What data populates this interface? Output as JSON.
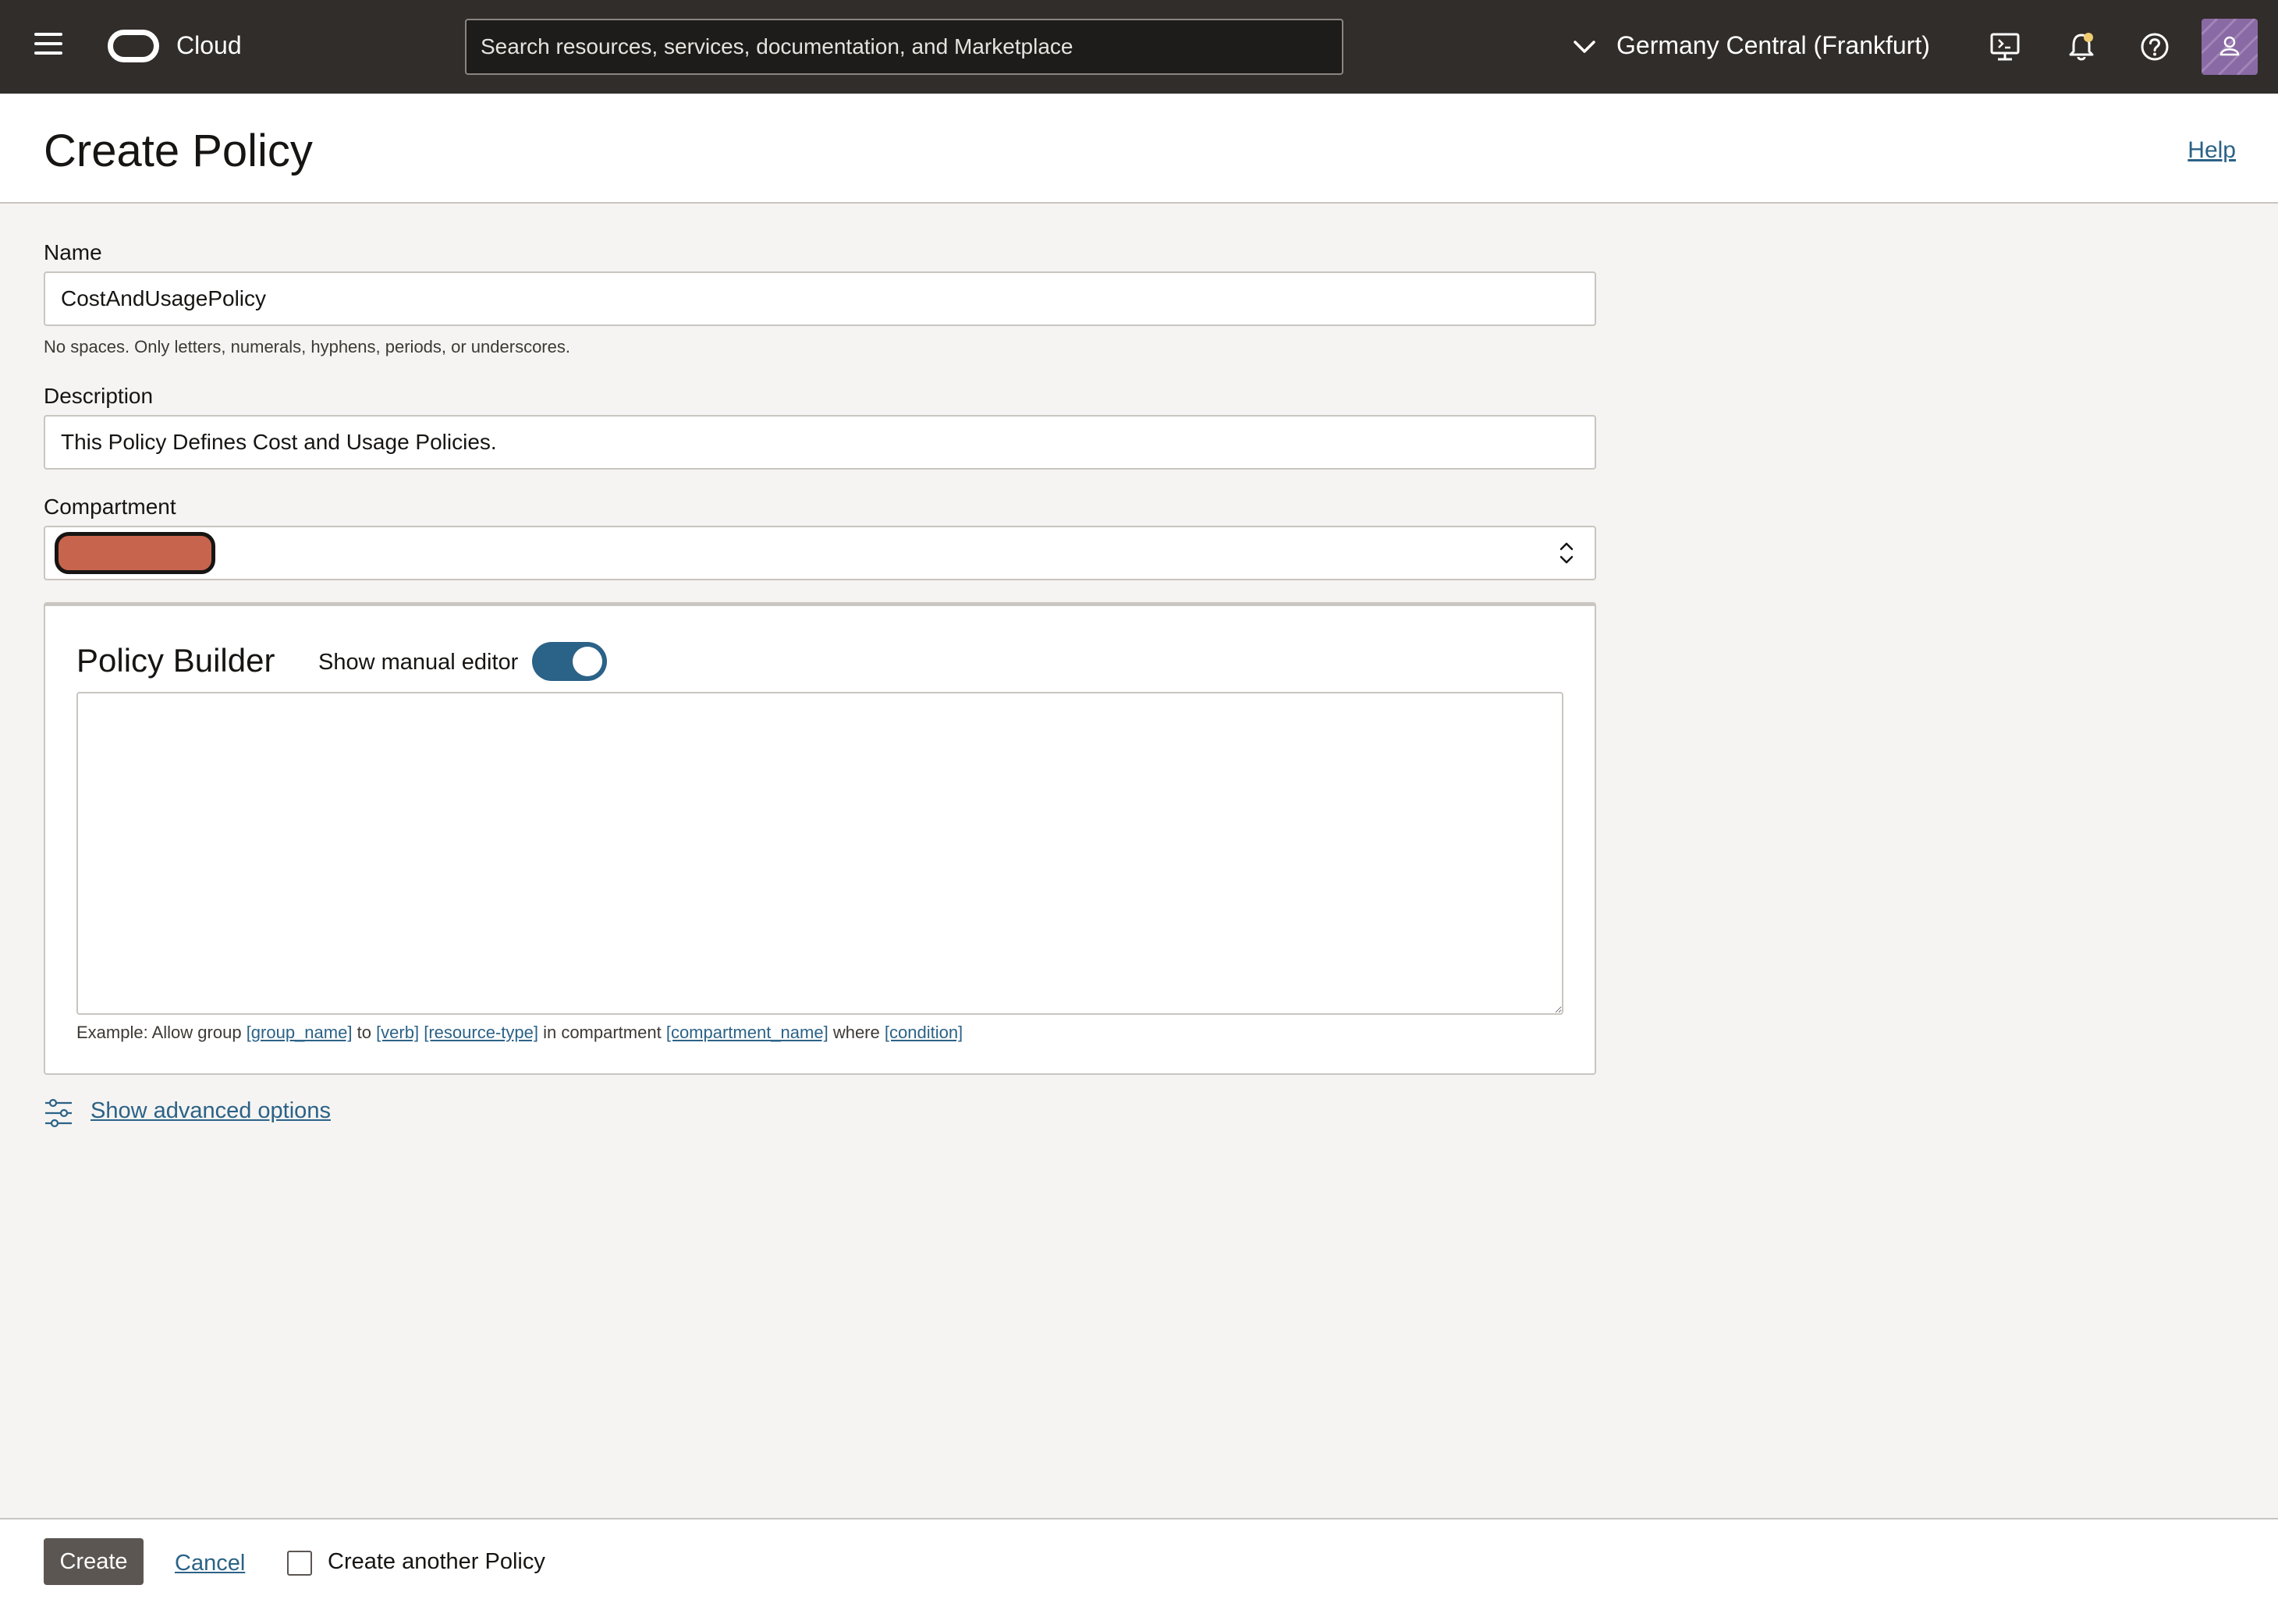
{
  "topbar": {
    "brand": "Cloud",
    "search_placeholder": "Search resources, services, documentation, and Marketplace",
    "region": "Germany Central (Frankfurt)",
    "icons": [
      "menu-icon",
      "chevron-down-icon",
      "cloud-shell-icon",
      "bell-icon",
      "help-icon",
      "user-icon"
    ],
    "accent_color": "#312d2a"
  },
  "header": {
    "title": "Create Policy",
    "help_label": "Help"
  },
  "form": {
    "name_label": "Name",
    "name_value": "CostAndUsagePolicy",
    "name_hint": "No spaces. Only letters, numerals, hyphens, periods, or underscores.",
    "description_label": "Description",
    "description_value": "This Policy Defines Cost and Usage Policies.",
    "compartment_label": "Compartment"
  },
  "builder": {
    "title": "Policy Builder",
    "toggle_label": "Show manual editor",
    "toggle_on": true,
    "editor_value": "",
    "example": {
      "prefix": "Example: Allow group",
      "group": "[group_name]",
      "to": "to",
      "verb": "[verb]",
      "resource": "[resource-type]",
      "in": "in compartment",
      "compartment": "[compartment_name]",
      "where": "where",
      "condition": "[condition]"
    }
  },
  "advanced": {
    "label": "Show advanced options"
  },
  "footer": {
    "create_label": "Create",
    "cancel_label": "Cancel",
    "another_label": "Create another Policy",
    "another_checked": false
  },
  "colors": {
    "link": "#2b6287",
    "toggle": "#2b6287",
    "button": "#5b5652"
  }
}
